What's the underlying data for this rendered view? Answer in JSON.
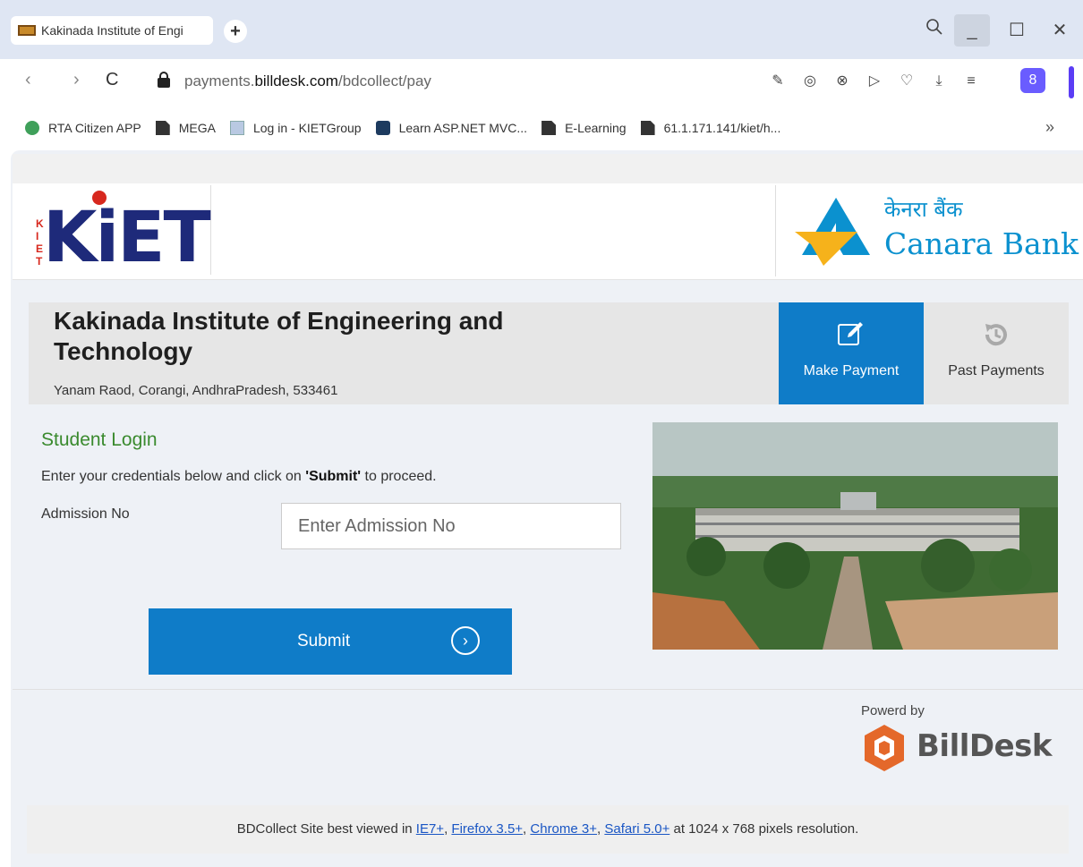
{
  "browser": {
    "tab_title": "Kakinada Institute of Engi",
    "new_tab_icon": "plus-icon",
    "url_prefix": "payments.",
    "url_domain": "billdesk.com",
    "url_path": "/bdcollect/pay",
    "profile_letter": "8",
    "bookmarks": [
      {
        "label": "RTA Citizen APP",
        "icon": "rta-icon"
      },
      {
        "label": "MEGA",
        "icon": "document-icon"
      },
      {
        "label": "Log in - KIETGroup",
        "icon": "page-icon"
      },
      {
        "label": "Learn ASP.NET MVC...",
        "icon": "asp-icon"
      },
      {
        "label": "E-Learning",
        "icon": "document-icon"
      },
      {
        "label": "61.1.171.141/kiet/h...",
        "icon": "document-icon"
      }
    ],
    "bookmarks_more": "»"
  },
  "header": {
    "kiet_logo": "KiET",
    "kiet_vertical": [
      "K",
      "I",
      "E",
      "T"
    ],
    "bank_hindi": "केनरा बैंक",
    "bank_english": "Canara Bank"
  },
  "institute": {
    "name": "Kakinada Institute of Engineering and Technology",
    "address": "Yanam Raod, Corangi, AndhraPradesh, 533461"
  },
  "actions": {
    "make_payment": "Make Payment",
    "past_payments": "Past Payments"
  },
  "form": {
    "title": "Student Login",
    "instruction_pre": "Enter your credentials below and click on ",
    "instruction_bold": "'Submit'",
    "instruction_post": " to proceed.",
    "admission_label": "Admission No",
    "admission_placeholder": "Enter Admission No",
    "submit_label": "Submit"
  },
  "powered": {
    "label": "Powerd by",
    "brand": "BillDesk"
  },
  "footer": {
    "pre": "BDCollect Site best viewed in ",
    "links": [
      "IE7+",
      "Firefox 3.5+",
      "Chrome 3+",
      "Safari 5.0+"
    ],
    "post": " at 1024 x 768 pixels resolution."
  },
  "colors": {
    "accent_blue": "#0f7cc8",
    "login_green": "#3a8a2e",
    "canara_blue": "#0b91cf",
    "canara_yellow": "#f6b21b",
    "kiet_navy": "#1e2a7a",
    "kiet_red": "#d7281e",
    "billdesk_orange": "#e4682a"
  }
}
